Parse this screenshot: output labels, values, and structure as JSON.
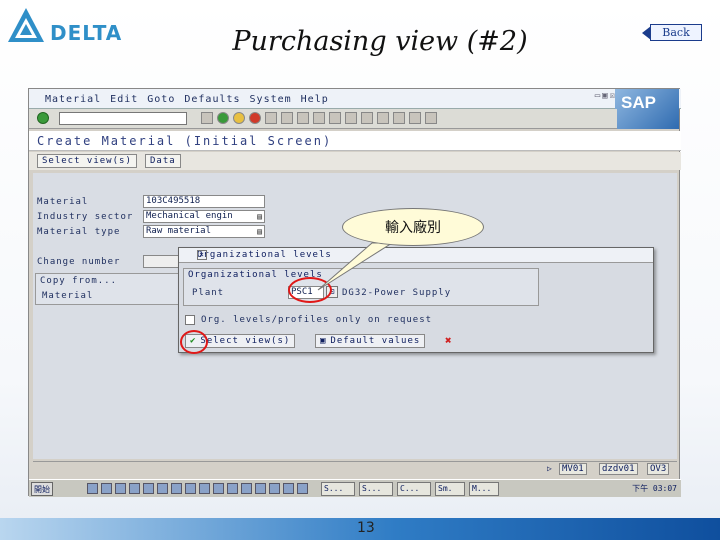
{
  "slide": {
    "title": "Purchasing view (#2)",
    "back_label": "Back",
    "logo_text": "DELTA",
    "page_number": "13"
  },
  "sap": {
    "logo_text": "SAP",
    "menu": [
      "Material",
      "Edit",
      "Goto",
      "Defaults",
      "System",
      "Help"
    ],
    "screen_title": "Create Material (Initial Screen)",
    "app_buttons": [
      "Select view(s)",
      "Data"
    ],
    "fields": {
      "material_label": "Material",
      "material_value": "103C495518",
      "industry_label": "Industry sector",
      "industry_value": "Mechanical engin",
      "type_label": "Material type",
      "type_value": "Raw material",
      "change_label": "Change number",
      "copy_from_label": "Copy from...",
      "copy_material_label": "Material"
    },
    "status_bar": [
      "MV01",
      "dzdv01",
      "OV3"
    ],
    "taskbar": {
      "start": "開始",
      "buttons": [
        "S...",
        "S...",
        "C...",
        "Sm.",
        "M..."
      ],
      "clock": "下午 03:07"
    }
  },
  "dialog": {
    "title": "Organizational levels",
    "section_label": "Organizational levels",
    "plant_label": "Plant",
    "plant_value": "PSC1",
    "plant_desc": "DG32-Power Supply",
    "checkbox_label": "Org. levels/profiles only on request",
    "select_views": "Select view(s)",
    "default_values": "Default values"
  },
  "callout": {
    "text": "輸入廠別"
  }
}
